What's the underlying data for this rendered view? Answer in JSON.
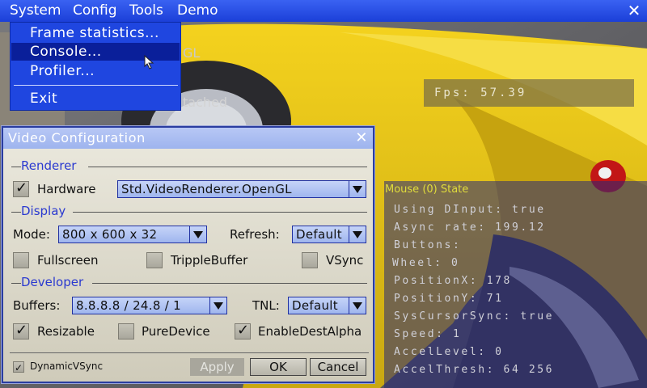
{
  "menubar": {
    "items": [
      {
        "label": "System"
      },
      {
        "label": "Config"
      },
      {
        "label": "Tools"
      },
      {
        "label": "Demo"
      }
    ],
    "close_glyph": "✕"
  },
  "system_menu": {
    "items": [
      {
        "label": "Frame statistics..."
      },
      {
        "label": "Console...",
        "selected": true
      },
      {
        "label": "Profiler..."
      },
      {
        "label": "Exit"
      }
    ]
  },
  "hud": {
    "bg_fragment_1": "GL",
    "bg_fragment_2": "tached",
    "fps": "Fps: 57.39",
    "mouse_panel": {
      "title": "Mouse (0) State",
      "lines": [
        "Using DInput: true",
        "Async rate: 199.12",
        "Buttons:",
        "Wheel: 0",
        "PositionX: 178",
        "PositionY: 71",
        "SysCursorSync: true",
        "Speed: 1",
        "AccelLevel: 0",
        "AccelThresh: 64 256"
      ]
    }
  },
  "video_config": {
    "title": "Video Configuration",
    "close_glyph": "✕",
    "sections": {
      "renderer": "Renderer",
      "display": "Display",
      "developer": "Developer"
    },
    "renderer": {
      "hardware_label": "Hardware",
      "hardware_checked": true,
      "renderer_select": "Std.VideoRenderer.OpenGL"
    },
    "display": {
      "mode_label": "Mode:",
      "mode_select": "800 x 600 x 32",
      "refresh_label": "Refresh:",
      "refresh_select": "Default",
      "fullscreen_label": "Fullscreen",
      "fullscreen_checked": false,
      "tripplebuffer_label": "TrippleBuffer",
      "tripplebuffer_checked": false,
      "vsync_label": "VSync",
      "vsync_checked": false
    },
    "developer": {
      "buffers_label": "Buffers:",
      "buffers_select": "8.8.8.8 / 24.8 / 1",
      "tnl_label": "TNL:",
      "tnl_select": "Default",
      "resizable_label": "Resizable",
      "resizable_checked": true,
      "puredevice_label": "PureDevice",
      "puredevice_checked": false,
      "enabledestalpha_label": "EnableDestAlpha",
      "enabledestalpha_checked": true
    },
    "footer": {
      "dynamicvsync_label": "DynamicVSync",
      "dynamicvsync_checked": true,
      "apply_label": "Apply",
      "ok_label": "OK",
      "cancel_label": "Cancel"
    },
    "check_glyph": "✓"
  },
  "colors": {
    "menubar": "#2a52e8",
    "menu_selected": "#0a1f9a",
    "section_label": "#2a39d0",
    "car_yellow": "#e8c51a",
    "hud_text": "#e0dc3c"
  }
}
